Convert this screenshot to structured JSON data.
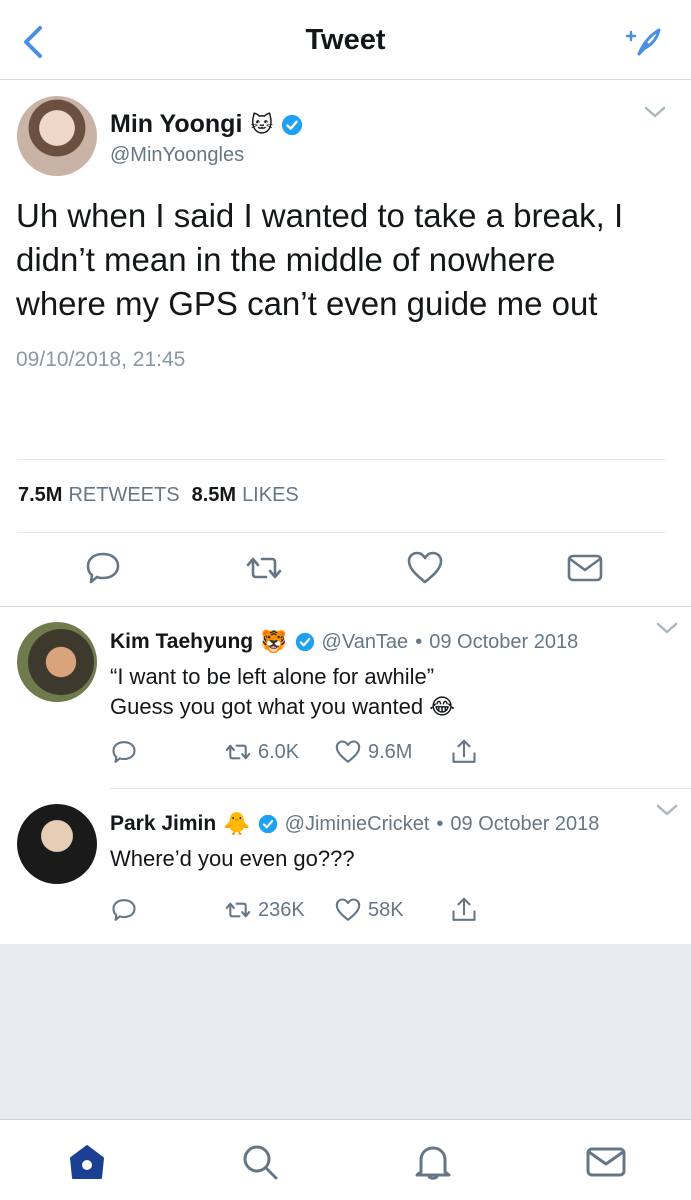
{
  "header": {
    "title": "Tweet"
  },
  "main_tweet": {
    "author_name": "Min Yoongi",
    "author_emoji": "🐱",
    "handle": "@MinYoongles",
    "text_lines": [
      "Uh when I said I wanted to take a break, I",
      "didn’t mean in the middle of nowhere",
      "where my GPS can’t even guide me out"
    ],
    "timestamp": "09/10/2018, 21:45",
    "retweets_count": "7.5M",
    "retweets_label": "RETWEETS",
    "likes_count": "8.5M",
    "likes_label": "LIKES"
  },
  "replies": [
    {
      "name": "Kim Taehyung",
      "emoji": "🐯",
      "handle": "@VanTae",
      "date": "09 October 2018",
      "text_lines": [
        "“I want to be left alone for awhile”",
        "Guess you got what you wanted 😂"
      ],
      "retweets": "6.0K",
      "likes": "9.6M"
    },
    {
      "name": "Park Jimin",
      "emoji": "🐥",
      "handle": "@JiminieCricket",
      "date": "09 October 2018",
      "text_lines": [
        "Where’d you even go???"
      ],
      "retweets": "236K",
      "likes": "58K"
    }
  ],
  "separator": "•",
  "colors": {
    "accent": "#1da1f2",
    "nav_active": "#1b3f93",
    "text_primary": "#14171a",
    "text_secondary": "#657786",
    "background_empty": "#e9ebef"
  }
}
